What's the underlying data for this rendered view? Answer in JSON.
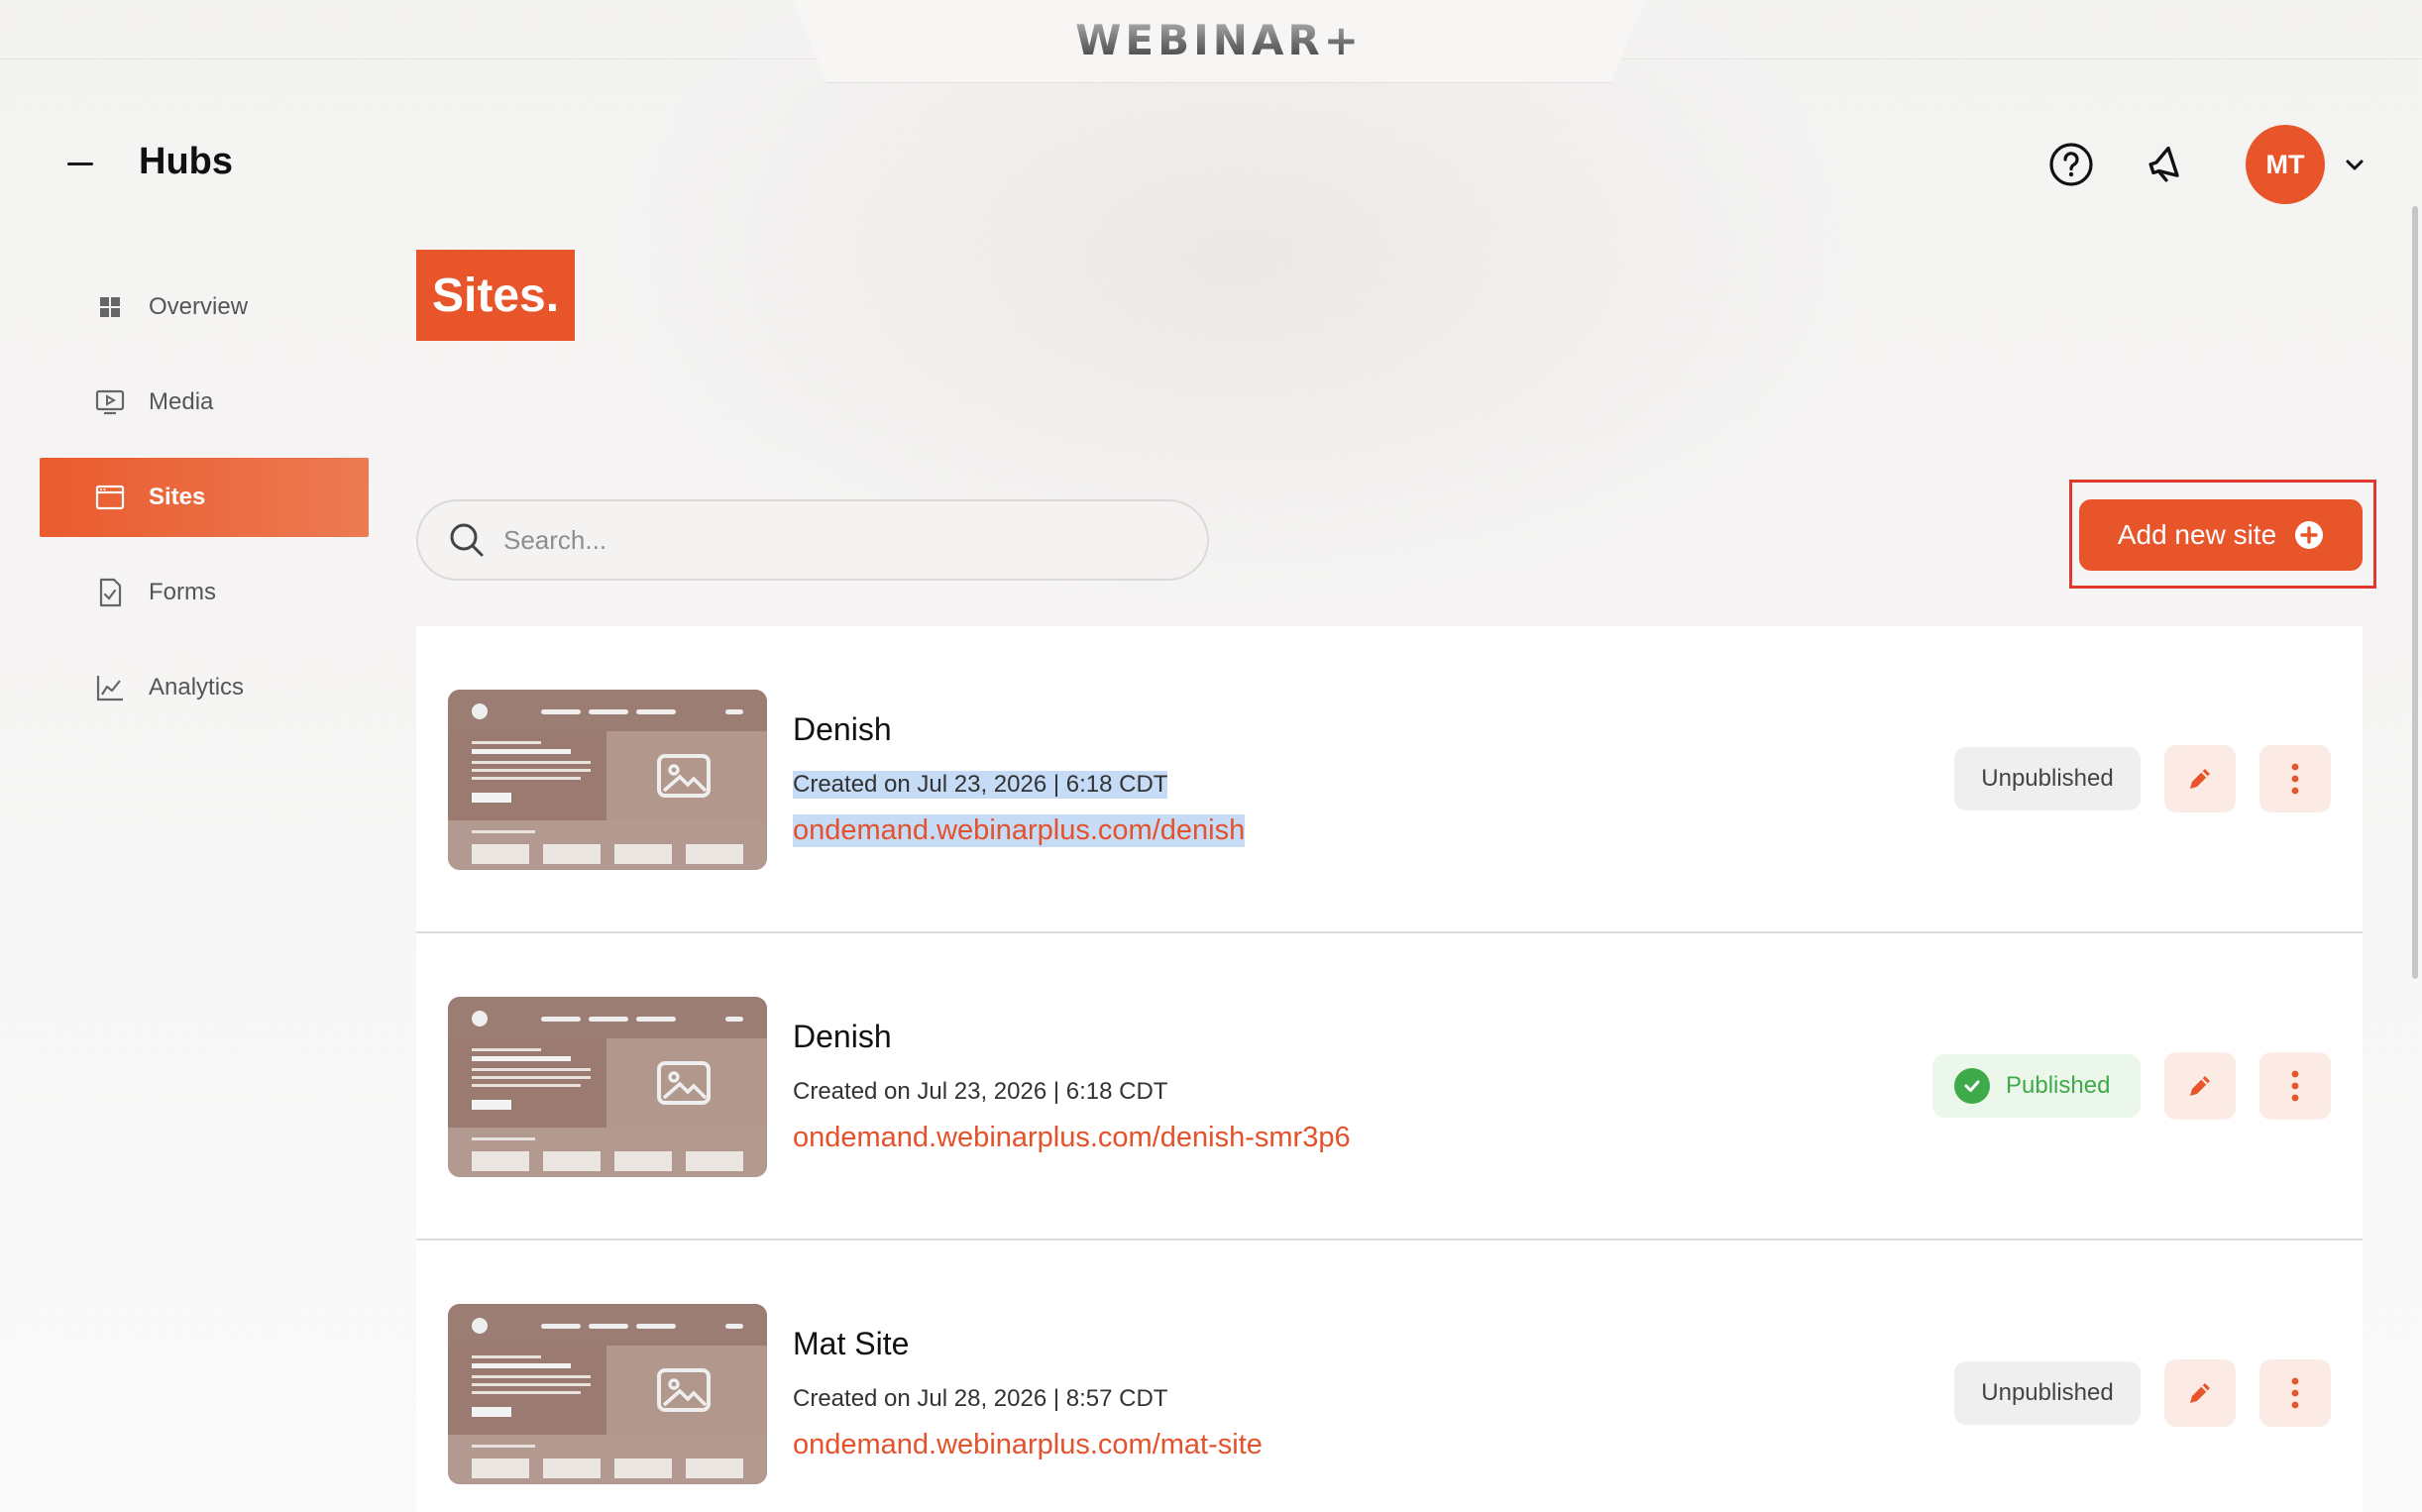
{
  "brand": {
    "logo_text": "WEBINAR+"
  },
  "header": {
    "title": "Hubs",
    "avatar_initials": "MT"
  },
  "sidebar": {
    "items": [
      {
        "label": "Overview",
        "icon": "grid-icon",
        "active": false
      },
      {
        "label": "Media",
        "icon": "monitor-play-icon",
        "active": false
      },
      {
        "label": "Sites",
        "icon": "browser-window-icon",
        "active": true
      },
      {
        "label": "Forms",
        "icon": "document-check-icon",
        "active": false
      },
      {
        "label": "Analytics",
        "icon": "line-chart-icon",
        "active": false
      }
    ]
  },
  "page": {
    "heading": "Sites."
  },
  "search": {
    "placeholder": "Search..."
  },
  "toolbar": {
    "add_label": "Add new site"
  },
  "sites": [
    {
      "name": "Denish",
      "created": "Created on Jul 23, 2026 | 6:18 CDT",
      "url": "ondemand.webinarplus.com/denish",
      "status": "Unpublished"
    },
    {
      "name": "Denish",
      "created": "Created on Jul 23, 2026 | 6:18 CDT",
      "url": "ondemand.webinarplus.com/denish-smr3p6",
      "status": "Published"
    },
    {
      "name": "Mat Site",
      "created": "Created on Jul 28, 2026 | 8:57 CDT",
      "url": "ondemand.webinarplus.com/mat-site",
      "status": "Unpublished"
    }
  ],
  "colors": {
    "accent": "#e8552a",
    "published": "#3faa49",
    "highlight_box": "#e0382c"
  }
}
